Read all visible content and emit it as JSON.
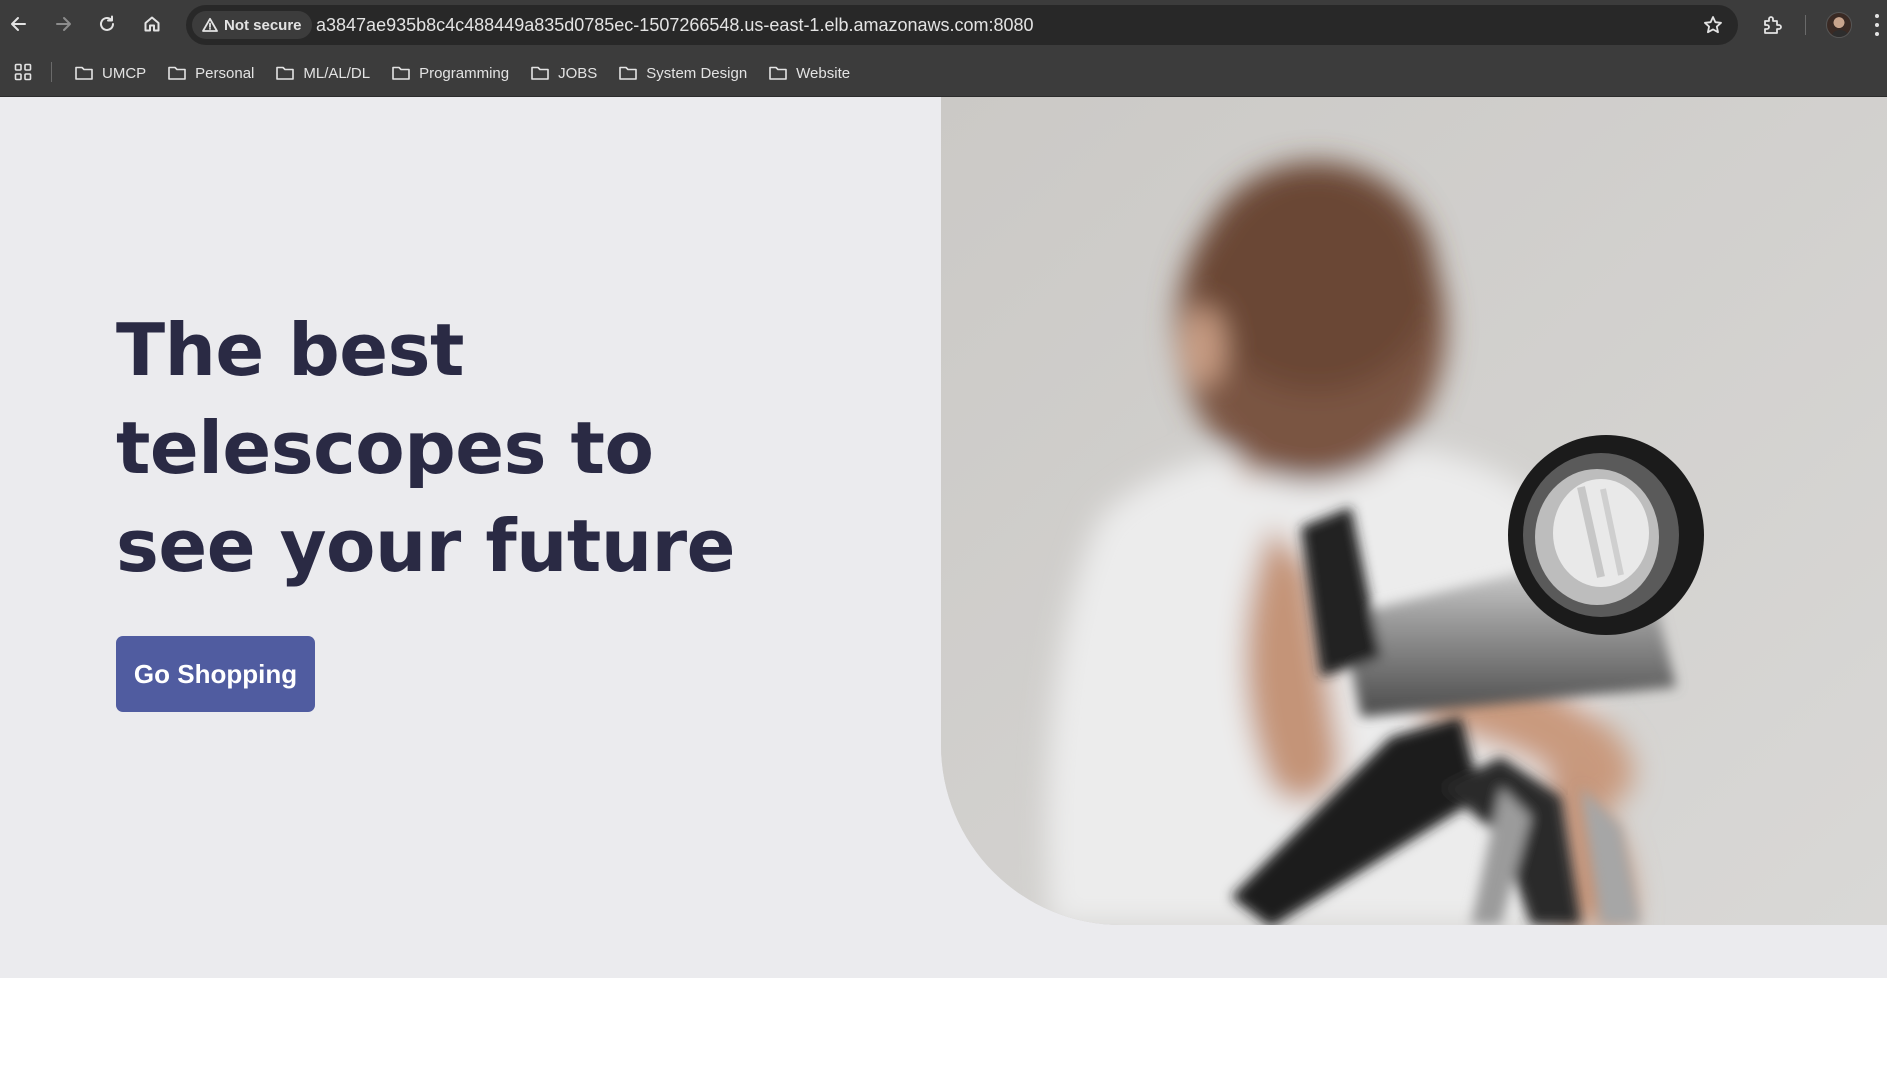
{
  "browser": {
    "security_label": "Not secure",
    "url": "a3847ae935b8c4c488449a835d0785ec-1507266548.us-east-1.elb.amazonaws.com:8080",
    "icons": {
      "back": "arrow-left-icon",
      "forward": "arrow-right-icon",
      "reload": "reload-icon",
      "home": "home-icon",
      "security": "warning-triangle-icon",
      "bookmark": "star-icon",
      "extensions": "puzzle-icon",
      "menu": "three-dots-icon"
    }
  },
  "bookmarks": [
    {
      "label": "UMCP"
    },
    {
      "label": "Personal"
    },
    {
      "label": "ML/AL/DL"
    },
    {
      "label": "Programming"
    },
    {
      "label": "JOBS"
    },
    {
      "label": "System Design"
    },
    {
      "label": "Website"
    }
  ],
  "hero": {
    "title_lines": [
      "The best",
      "telescopes to",
      "see your future"
    ],
    "cta_label": "Go Shopping",
    "image_subject": "child looking through a telescope"
  },
  "colors": {
    "hero_background": "#ebebee",
    "title_color": "#2a2a44",
    "cta_background": "#505ca0",
    "chrome_background": "#3c3c3c"
  }
}
